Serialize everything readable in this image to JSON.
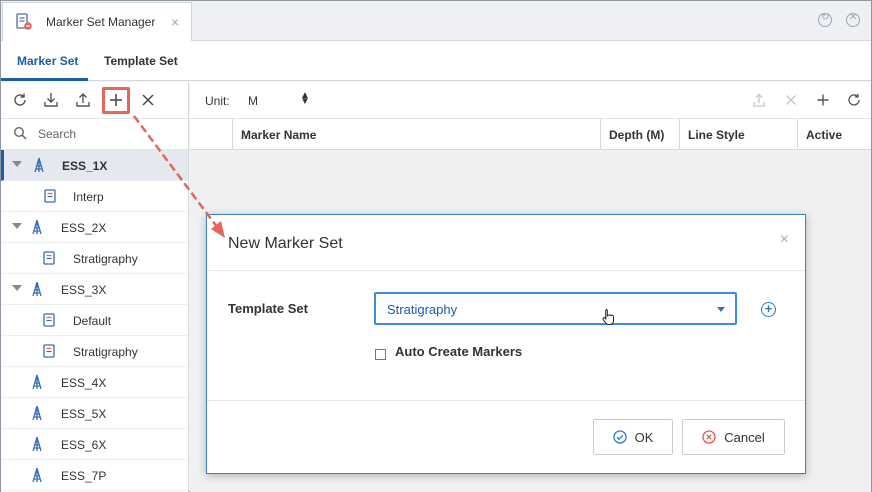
{
  "window": {
    "tab_title": "Marker Set Manager",
    "tab_close": "×"
  },
  "subtabs": [
    "Marker Set",
    "Template Set"
  ],
  "left": {
    "search_placeholder": "Search",
    "tree": [
      {
        "label": "ESS_1X",
        "type": "well",
        "expanded": true,
        "selected": true
      },
      {
        "label": "Interp",
        "type": "set"
      },
      {
        "label": "ESS_2X",
        "type": "well",
        "expanded": true
      },
      {
        "label": "Stratigraphy",
        "type": "set"
      },
      {
        "label": "ESS_3X",
        "type": "well",
        "expanded": true
      },
      {
        "label": "Default",
        "type": "set"
      },
      {
        "label": "Stratigraphy",
        "type": "set"
      },
      {
        "label": "ESS_4X",
        "type": "well"
      },
      {
        "label": "ESS_5X",
        "type": "well"
      },
      {
        "label": "ESS_6X",
        "type": "well"
      },
      {
        "label": "ESS_7P",
        "type": "well"
      }
    ]
  },
  "right": {
    "unit_label": "Unit:",
    "unit_value": "M",
    "columns": [
      "Marker Name",
      "Depth (M)",
      "Line Style",
      "Active"
    ]
  },
  "dialog": {
    "title": "New Marker Set",
    "close": "×",
    "template_set_label": "Template Set",
    "template_set_value": "Stratigraphy",
    "auto_create_label": "Auto Create Markers",
    "auto_create_checked": false,
    "ok_label": "OK",
    "cancel_label": "Cancel"
  },
  "colors": {
    "accent": "#1a5da8",
    "highlight": "#e5665a",
    "focus": "#3b8de0"
  }
}
